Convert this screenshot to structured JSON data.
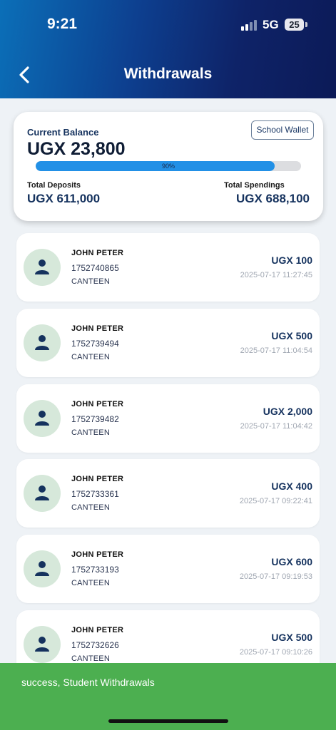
{
  "status_bar": {
    "time": "9:21",
    "network": "5G",
    "battery": "25"
  },
  "header": {
    "title": "Withdrawals",
    "back_icon": "chevron-left-icon"
  },
  "balance": {
    "label": "Current Balance",
    "value": "UGX 23,800",
    "wallet_button": "School Wallet",
    "progress": 0.9,
    "progress_text": "90%",
    "deposits_label": "Total Deposits",
    "deposits_value": "UGX 611,000",
    "spendings_label": "Total Spendings",
    "spendings_value": "UGX 688,100"
  },
  "transactions": [
    {
      "name": "JOHN PETER",
      "ref": "1752740865",
      "merchant": "CANTEEN",
      "amount": "UGX 100",
      "date": "2025-07-17 11:27:45"
    },
    {
      "name": "JOHN PETER",
      "ref": "1752739494",
      "merchant": "CANTEEN",
      "amount": "UGX 500",
      "date": "2025-07-17 11:04:54"
    },
    {
      "name": "JOHN PETER",
      "ref": "1752739482",
      "merchant": "CANTEEN",
      "amount": "UGX 2,000",
      "date": "2025-07-17 11:04:42"
    },
    {
      "name": "JOHN PETER",
      "ref": "1752733361",
      "merchant": "CANTEEN",
      "amount": "UGX 400",
      "date": "2025-07-17 09:22:41"
    },
    {
      "name": "JOHN PETER",
      "ref": "1752733193",
      "merchant": "CANTEEN",
      "amount": "UGX 600",
      "date": "2025-07-17 09:19:53"
    },
    {
      "name": "JOHN PETER",
      "ref": "1752732626",
      "merchant": "CANTEEN",
      "amount": "UGX 500",
      "date": "2025-07-17 09:10:26"
    }
  ],
  "toast": {
    "message": "success, Student Withdrawals"
  },
  "colors": {
    "header_start": "#0b6fb8",
    "header_end": "#0c1a57",
    "accent": "#2290e6",
    "toast": "#4caf50",
    "avatar_bg": "#d6e8da"
  }
}
